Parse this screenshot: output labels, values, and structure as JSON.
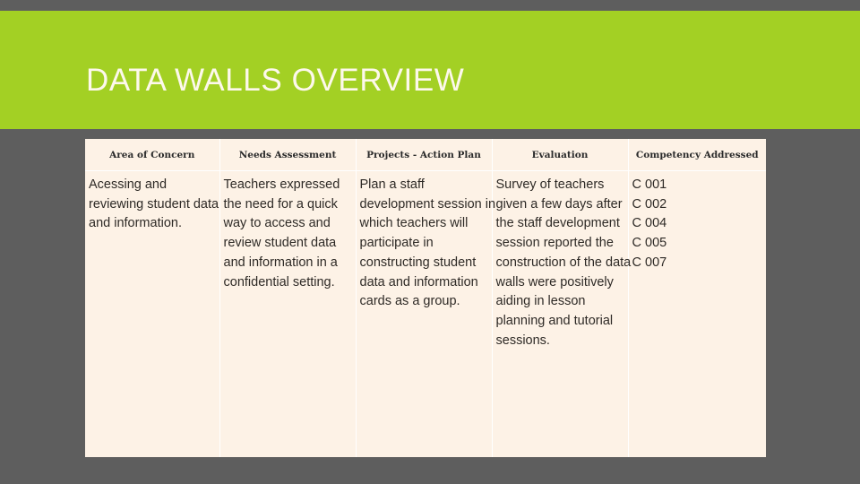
{
  "slide": {
    "title": "DATA WALLS OVERVIEW",
    "colors": {
      "background": "#5e5e5e",
      "title_band": "#a3d024",
      "title_text": "#fdf8ec",
      "table_cell": "#fdf2e6",
      "grid_line": "#ffffff",
      "body_text": "#2e2a26"
    }
  },
  "table": {
    "headers": [
      "Area of Concern",
      "Needs Assessment",
      "Projects - Action Plan",
      "Evaluation",
      "Competency Addressed"
    ],
    "rows": [
      {
        "area_of_concern": "Acessing and reviewing student data and information.",
        "needs_assessment": "Teachers expressed the need for a quick way to access and review student data and information in a confidential setting.",
        "projects_action_plan": "Plan a staff development session in which teachers will participate in constructing student data and information cards as a group.",
        "evaluation": "Survey of teachers given a few days after the staff development session reported the construction of the data walls were positively aiding in lesson planning and tutorial sessions.",
        "competency_addressed": [
          "C 001",
          "C 002",
          "C 004",
          "C 005",
          "C 007"
        ]
      }
    ]
  }
}
